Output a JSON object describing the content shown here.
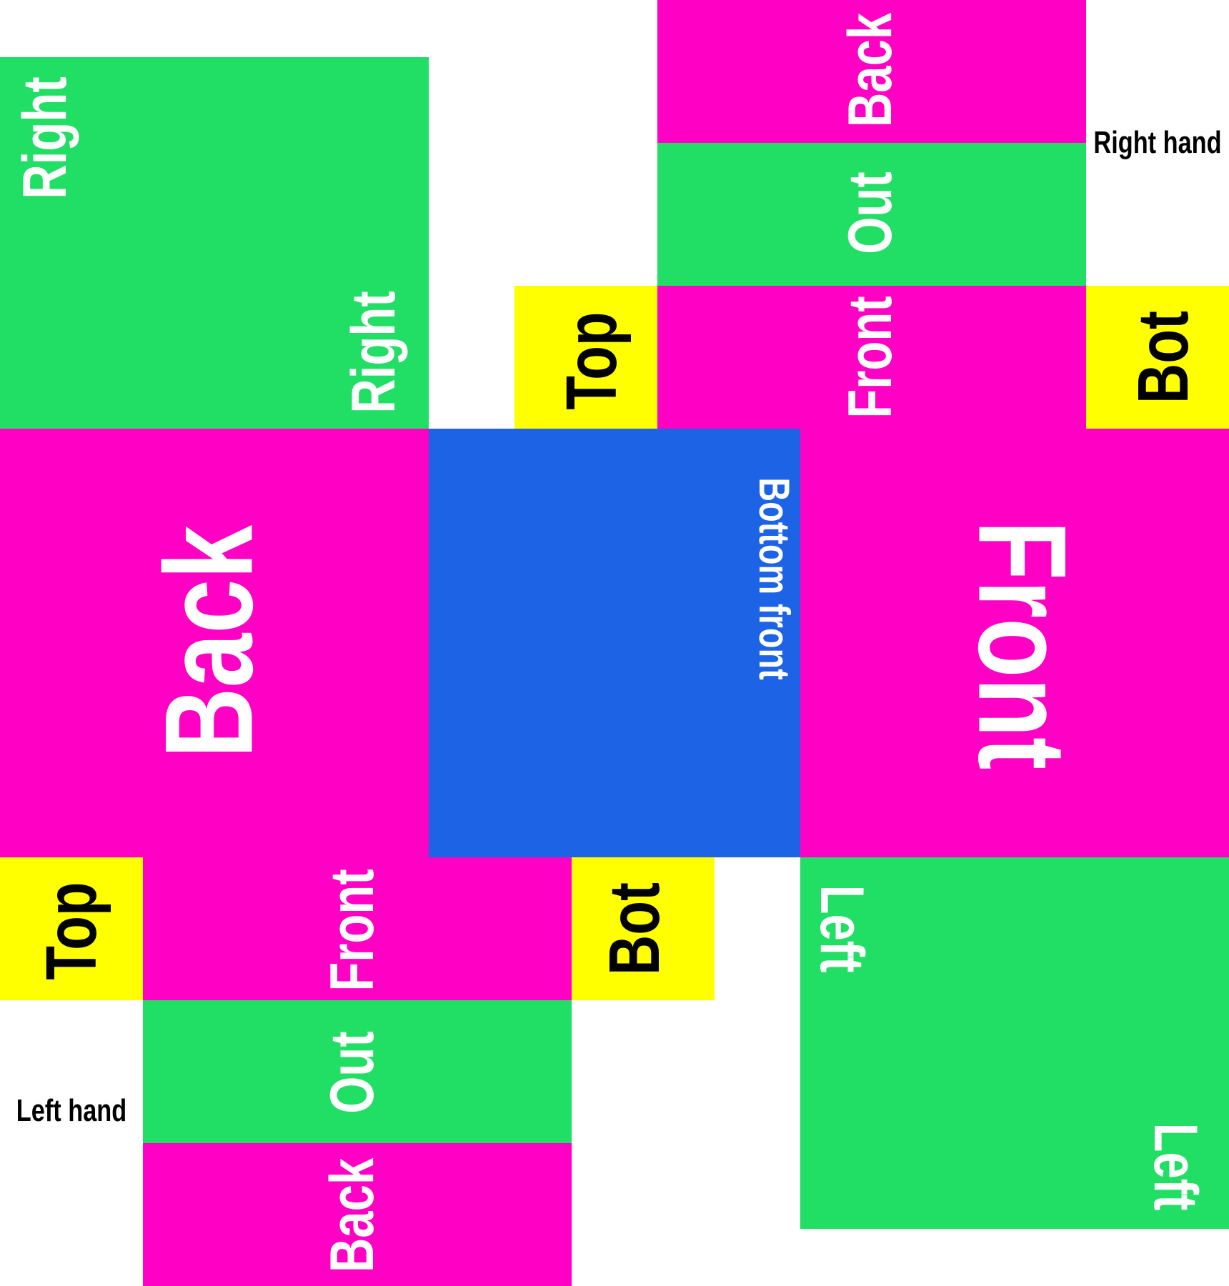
{
  "colors": {
    "magenta": "#ff00c4",
    "green": "#21de64",
    "yellow": "#ffff00",
    "blue": "#1c63e6",
    "white": "#ffffff",
    "black": "#000000"
  },
  "labels": {
    "right": "Right",
    "back": "Back",
    "front": "Front",
    "top": "Top",
    "bot": "Bot",
    "out": "Out",
    "left": "Left",
    "bottom_front": "Bottom front",
    "right_hand": "Right hand",
    "left_hand": "Left hand"
  }
}
